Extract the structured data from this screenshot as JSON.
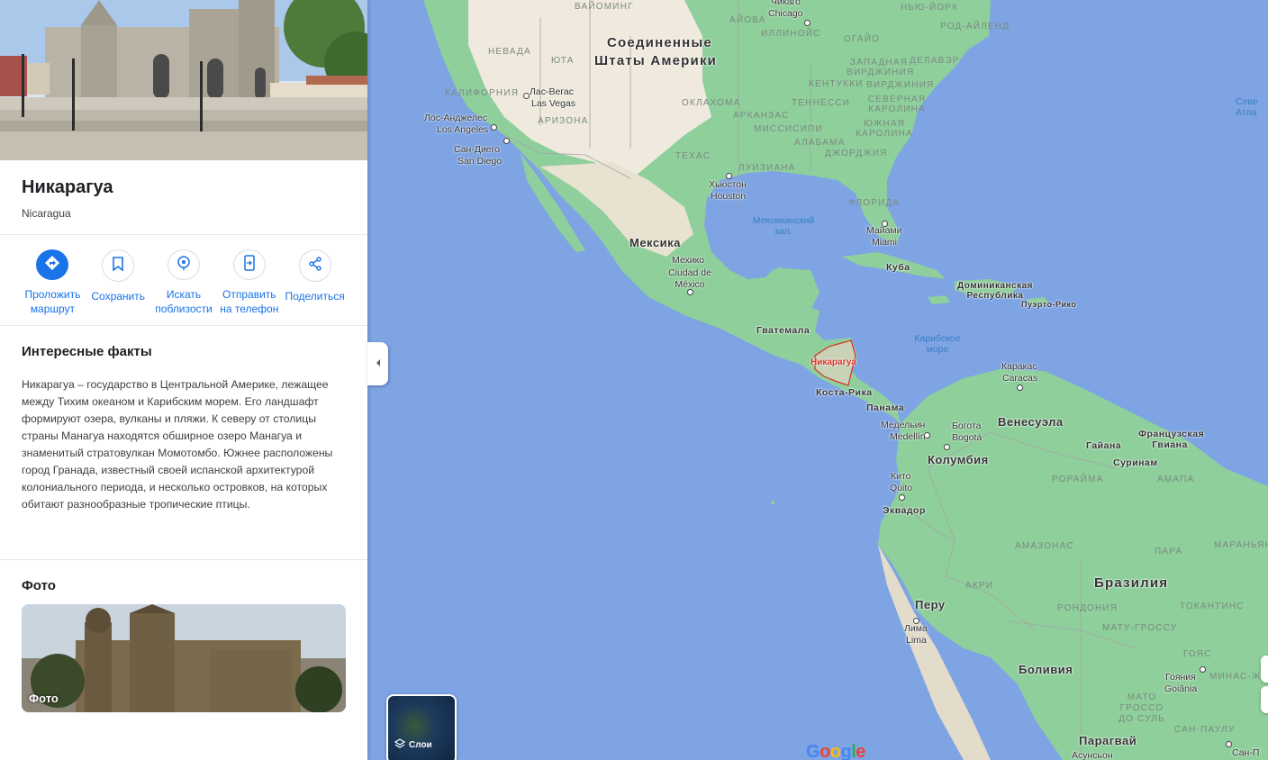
{
  "place": {
    "title": "Никарагуа",
    "subtitle": "Nicaragua"
  },
  "actions": [
    {
      "label": "Проложить маршрут",
      "icon": "directions-icon"
    },
    {
      "label": "Сохранить",
      "icon": "bookmark-icon"
    },
    {
      "label": "Искать поблизости",
      "icon": "nearby-icon"
    },
    {
      "label": "Отправить на телефон",
      "icon": "send-to-phone-icon"
    },
    {
      "label": "Поделиться",
      "icon": "share-icon"
    }
  ],
  "facts": {
    "heading": "Интересные факты",
    "text": "Никарагуа – государство в Центральной Америке, лежащее между Тихим океаном и Карибским морем. Его ландшафт формируют озера, вулканы и пляжи. К северу от столицы страны Манагуа находятся обширное озеро Манагуа и знаменитый стратовулкан Момотомбо. Южнее расположены город Гранада, известный своей испанской архитектурой колониального периода, и несколько островков, на которых обитают разнообразные тропические птицы."
  },
  "photos": {
    "heading": "Фото",
    "card_label": "Фото"
  },
  "map": {
    "layers_label": "Слои",
    "logo": "Google",
    "selected_label": "Никарагуа",
    "colors": {
      "water": "#aadaff",
      "land": "#8fcf9c",
      "land_dry": "#efeadd",
      "border": "#a0a0a0",
      "selected_border": "#d93025"
    },
    "labels": {
      "usa_1": "Соединенные",
      "usa_2": "Штаты Америки",
      "mexico": "Мексика",
      "guatemala": "Гватемала",
      "costa_rica": "Коста-Рика",
      "panama": "Панама",
      "venezuela": "Венесуэла",
      "colombia": "Колумбия",
      "ecuador": "Эквадор",
      "peru": "Перу",
      "brazil": "Бразилия",
      "bolivia": "Боливия",
      "paraguay": "Парагвай",
      "guyana": "Гайана",
      "suriname": "Суринам",
      "fr_guiana": "Французская Гвиана",
      "cuba": "Куба",
      "dominican": "Доминиканская Республика",
      "puerto_rico": "Пуэрто-Рико",
      "gulf_mexico": "Мексиканский зал.",
      "caribbean": "Карибское море",
      "north_atlantic": "Севе Атла",
      "nevada": "НЕВАДА",
      "utah": "ЮТА",
      "california": "КАЛИФОРНИЯ",
      "arizona": "АРИЗОНА",
      "texas": "ТЕХАС",
      "oklahoma": "ОКЛАХОМА",
      "arkansas": "АРКАНЗАС",
      "mississippi": "МИССИСИПИ",
      "alabama": "АЛАБАМА",
      "louisiana": "ЛУИЗИАНА",
      "tennessee": "ТЕННЕССИ",
      "georgia": "ДЖОРДЖИЯ",
      "florida": "ФЛОРИДА",
      "wyoming": "ВАЙОМИНГ",
      "iowa": "АЙОВА",
      "illinois": "ИЛЛИНОЙС",
      "ohio": "ОГАЙО",
      "kentucky": "КЕНТУККИ",
      "w_virginia": "ЗАПАДНАЯ ВИРДЖИНИЯ",
      "virginia": "ВИРДЖИНИЯ",
      "delaware": "ДЕЛАВЭР",
      "n_carolina": "СЕВЕРНАЯ КАРОЛИНА",
      "s_carolina": "ЮЖНАЯ КАРОЛИНА",
      "new_york": "НЬЮ-ЙОРК",
      "rhode_island": "РОД-АЙЛЕНД",
      "roraima": "РОРАЙМА",
      "amapa": "АМАПА",
      "amazonas": "АМАЗОНАС",
      "para": "ПАРА",
      "maranhao": "МАРАНЬЯН",
      "acre": "АКРИ",
      "rondonia": "РОНДОНИЯ",
      "tocantins": "ТОКАНТИНС",
      "mato_grosso": "МАТУ-ГРОССУ",
      "goias": "ГОЯС",
      "minas": "МИНАС-Ж",
      "ms": "МАТО ГРОССО ДО СУЛЬ",
      "sao_paulo": "САН-ПАУЛУ",
      "las_vegas_ru": "Лас-Вегас",
      "las_vegas": "Las Vegas",
      "la_ru": "Лос-Анджелес",
      "la": "Los Angeles",
      "sd_ru": "Сан-Диего",
      "sd": "San Diego",
      "chicago_ru": "Чикаго",
      "chicago": "Chicago",
      "houston_ru": "Хьюстон",
      "houston": "Houston",
      "miami_ru": "Майами",
      "miami": "Miami",
      "mexico_city_ru": "Мехико",
      "mexico_city": "Ciudad de México",
      "caracas_ru": "Каракас",
      "caracas": "Caracas",
      "bogota_ru": "Богота",
      "bogota": "Bogotá",
      "medellin_ru": "Медельин",
      "medellin": "Medellín",
      "quito_ru": "Кито",
      "quito": "Quito",
      "lima_ru": "Лима",
      "lima": "Lima",
      "goiania_ru": "Гояния",
      "goiania": "Goiânia",
      "sao_paulo_city": "Сан-П",
      "asuncion": "Асунсьон"
    }
  }
}
